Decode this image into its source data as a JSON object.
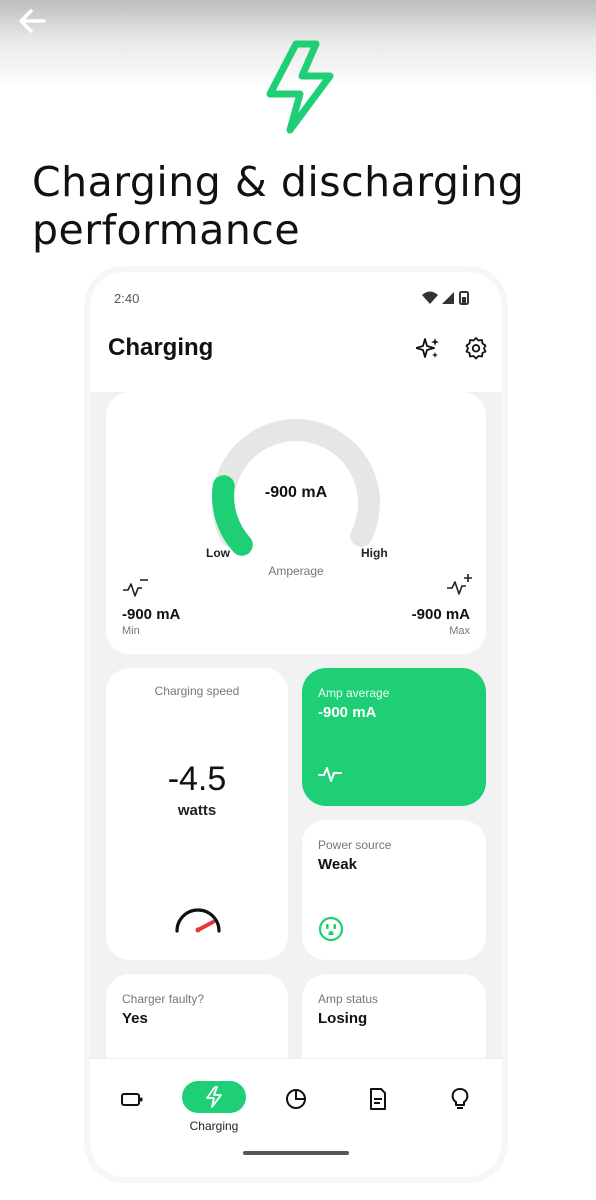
{
  "colors": {
    "accent": "#1fcf75",
    "gauge_track": "#e6e6e6",
    "card_bg": "#ffffff",
    "screen_bg": "#f2f2f2",
    "needle": "#e53935"
  },
  "icons": {
    "back": "arrow-left-icon",
    "hero": "lightning-bolt-icon",
    "sparkle": "sparkles-icon",
    "settings": "gear-icon",
    "min": "activity-minus-icon",
    "max": "activity-plus-icon",
    "amp": "activity-icon",
    "speedometer": "speedometer-icon",
    "outlet": "power-outlet-icon"
  },
  "headline": {
    "line1": "Charging & discharging",
    "line2": "performance"
  },
  "status_bar": {
    "time": "2:40"
  },
  "header": {
    "title": "Charging"
  },
  "gauge": {
    "value_text": "-900 mA",
    "low_label": "Low",
    "high_label": "High",
    "caption": "Amperage",
    "level": 0.18,
    "min": {
      "value": "-900 mA",
      "label": "Min"
    },
    "max": {
      "value": "-900 mA",
      "label": "Max"
    }
  },
  "speed": {
    "title": "Charging speed",
    "value": "-4.5",
    "unit": "watts"
  },
  "amp_average": {
    "label": "Amp average",
    "value": "-900 mA"
  },
  "power_source": {
    "label": "Power source",
    "value": "Weak"
  },
  "charger_faulty": {
    "label": "Charger faulty?",
    "value": "Yes"
  },
  "amp_status": {
    "label": "Amp status",
    "value": "Losing"
  },
  "nav": {
    "items": [
      {
        "icon": "battery-icon",
        "label": ""
      },
      {
        "icon": "lightning-bolt-icon",
        "label": "Charging",
        "active": true
      },
      {
        "icon": "pie-chart-icon",
        "label": ""
      },
      {
        "icon": "document-icon",
        "label": ""
      },
      {
        "icon": "lightbulb-icon",
        "label": ""
      }
    ]
  }
}
